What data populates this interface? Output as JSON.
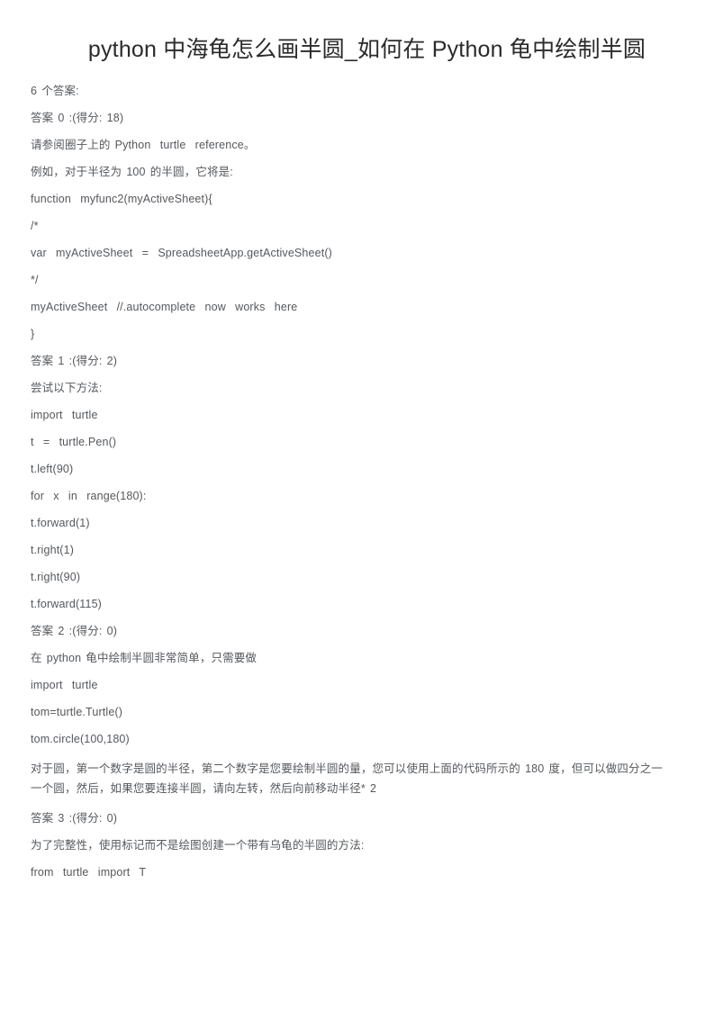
{
  "document": {
    "title": "python 中海龟怎么画半圆_如何在 Python 龟中绘制半圆",
    "answer_count_line": "6 个答案:",
    "lines": [
      {
        "text": "答案 0 :(得分: 18)",
        "wrap": false
      },
      {
        "text": "请参阅圈子上的 Python  turtle  reference。",
        "wrap": false
      },
      {
        "text": "例如，对于半径为 100 的半圆，它将是:",
        "wrap": false
      },
      {
        "text": "function  myfunc2(myActiveSheet){",
        "wrap": false
      },
      {
        "text": "/*",
        "wrap": false
      },
      {
        "text": "var  myActiveSheet  =  SpreadsheetApp.getActiveSheet()",
        "wrap": false
      },
      {
        "text": "*/",
        "wrap": false
      },
      {
        "text": "myActiveSheet  //.autocomplete  now  works  here",
        "wrap": false
      },
      {
        "text": "}",
        "wrap": false
      },
      {
        "text": "答案 1 :(得分: 2)",
        "wrap": false
      },
      {
        "text": "尝试以下方法:",
        "wrap": false
      },
      {
        "text": "import  turtle",
        "wrap": false
      },
      {
        "text": "t  =  turtle.Pen()",
        "wrap": false
      },
      {
        "text": "t.left(90)",
        "wrap": false
      },
      {
        "text": "for  x  in  range(180):",
        "wrap": false
      },
      {
        "text": "t.forward(1)",
        "wrap": false
      },
      {
        "text": "t.right(1)",
        "wrap": false
      },
      {
        "text": "t.right(90)",
        "wrap": false
      },
      {
        "text": "t.forward(115)",
        "wrap": false
      },
      {
        "text": "答案 2 :(得分: 0)",
        "wrap": false
      },
      {
        "text": "在 python 龟中绘制半圆非常简单，只需要做",
        "wrap": false
      },
      {
        "text": "import  turtle",
        "wrap": false
      },
      {
        "text": "tom=turtle.Turtle()",
        "wrap": false
      },
      {
        "text": "tom.circle(100,180)",
        "wrap": false
      },
      {
        "text": "对于圆，第一个数字是圆的半径，第二个数字是您要绘制半圆的量，您可以使用上面的代码所示的 180 度，但可以做四分之一一个圆，然后，如果您要连接半圆，请向左转，然后向前移动半径*  2",
        "wrap": true
      },
      {
        "text": "答案 3 :(得分: 0)",
        "wrap": false
      },
      {
        "text": "为了完整性，使用标记而不是绘图创建一个带有乌龟的半圆的方法:",
        "wrap": false
      },
      {
        "text": "from  turtle  import  T",
        "wrap": false
      }
    ]
  }
}
